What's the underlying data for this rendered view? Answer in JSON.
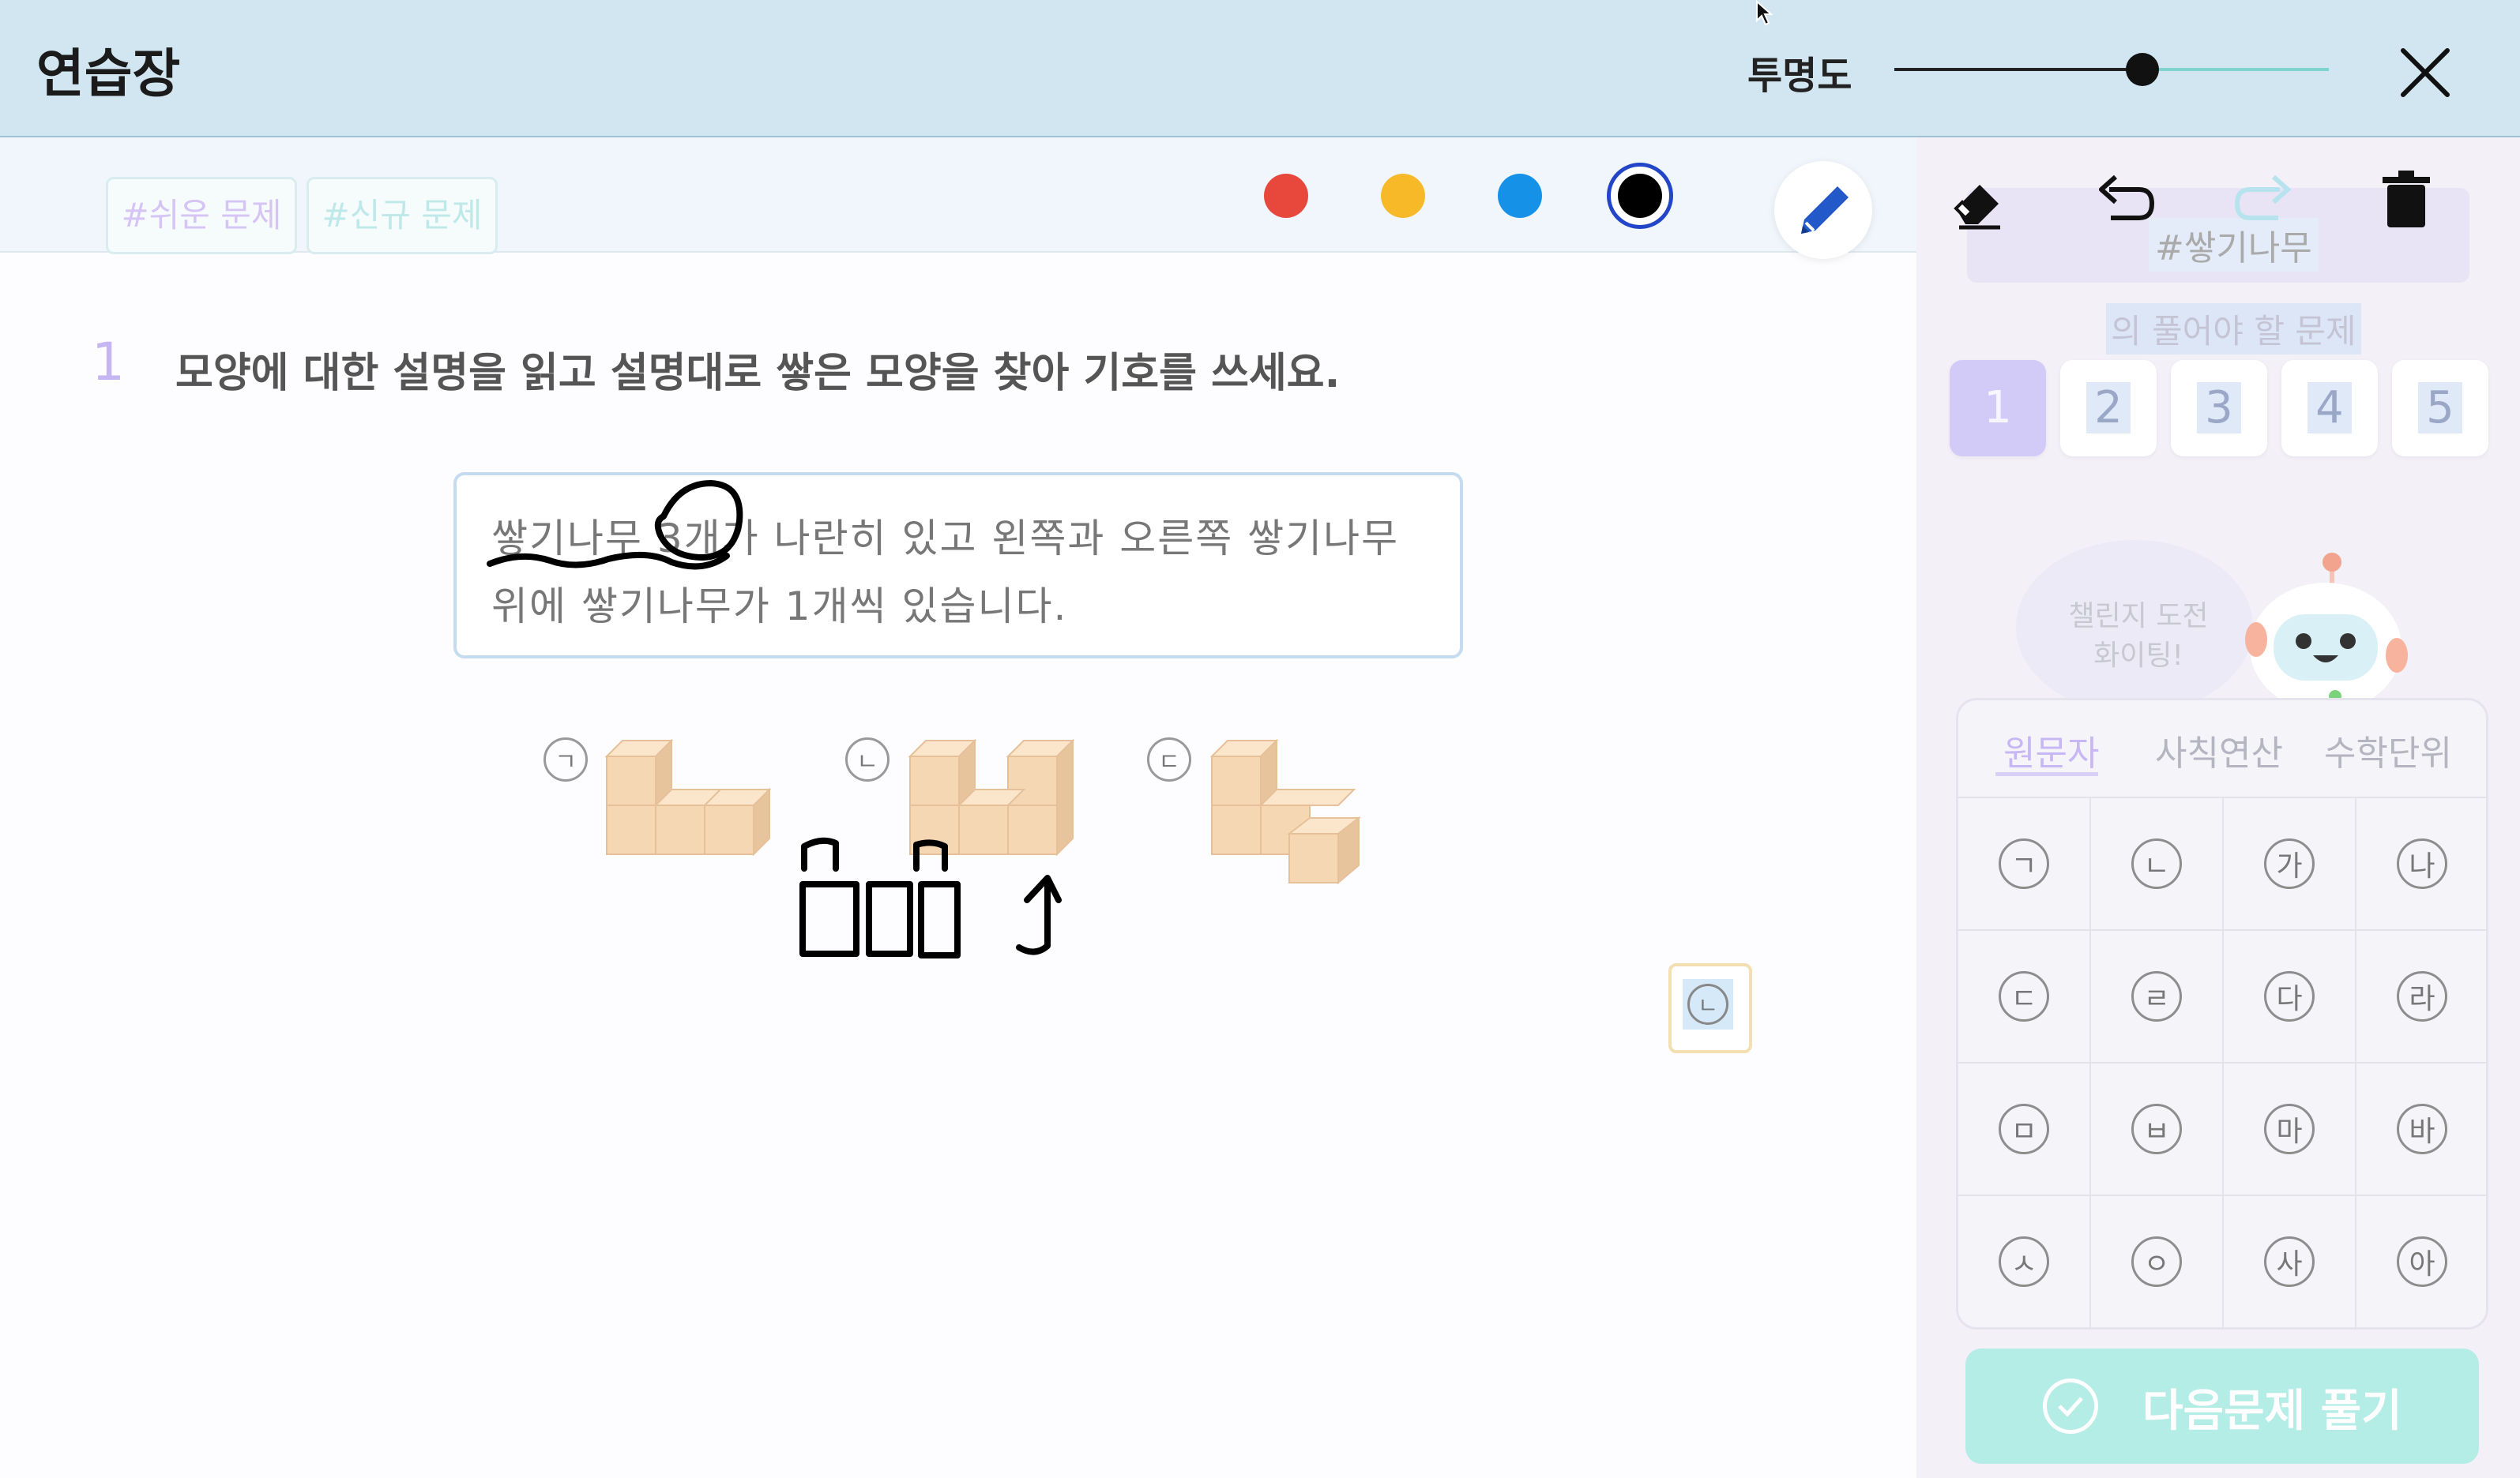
{
  "window": {
    "title": "연습장",
    "opacity_label": "투명도",
    "opacity_value": 0.57,
    "close_icon": "close-icon"
  },
  "tags": [
    "#쉬운 문제",
    "#신규 문제"
  ],
  "pen_colors": [
    "#e8473c",
    "#f7b928",
    "#1591e8",
    "#000000"
  ],
  "selected_color": "#000000",
  "tools": [
    "pencil-icon",
    "eraser-icon",
    "undo-icon",
    "redo-icon",
    "trash-icon"
  ],
  "question": {
    "number": "1",
    "text": "모양에 대한 설명을 읽고 설명대로 쌓은 모양을 찾아 기호를 쓰세요.",
    "description_line1": "쌓기나무 3개가 나란히 있고 왼쪽과 오른쪽 쌓기나무",
    "description_line2": "위에 쌓기나무가 1개씩 있습니다.",
    "options": [
      "ㄱ",
      "ㄴ",
      "ㄷ"
    ],
    "answer": "ㄴ"
  },
  "side_panel": {
    "keyword": "#쌓기나무",
    "subtitle": "의 풀어야 할 문제",
    "problem_numbers": [
      "1",
      "2",
      "3",
      "4",
      "5"
    ],
    "active_problem": "1",
    "mascot_speech": [
      "챌린지 도전",
      "화이팅!"
    ],
    "keypad_tabs": [
      "원문자",
      "사칙연산",
      "수학단위"
    ],
    "active_tab": "원문자",
    "keypad_keys": [
      "ㄱ",
      "ㄴ",
      "가",
      "나",
      "ㄷ",
      "ㄹ",
      "다",
      "라",
      "ㅁ",
      "ㅂ",
      "마",
      "바",
      "ㅅ",
      "ㅇ",
      "사",
      "아"
    ],
    "next_button": "다음문제 풀기"
  }
}
